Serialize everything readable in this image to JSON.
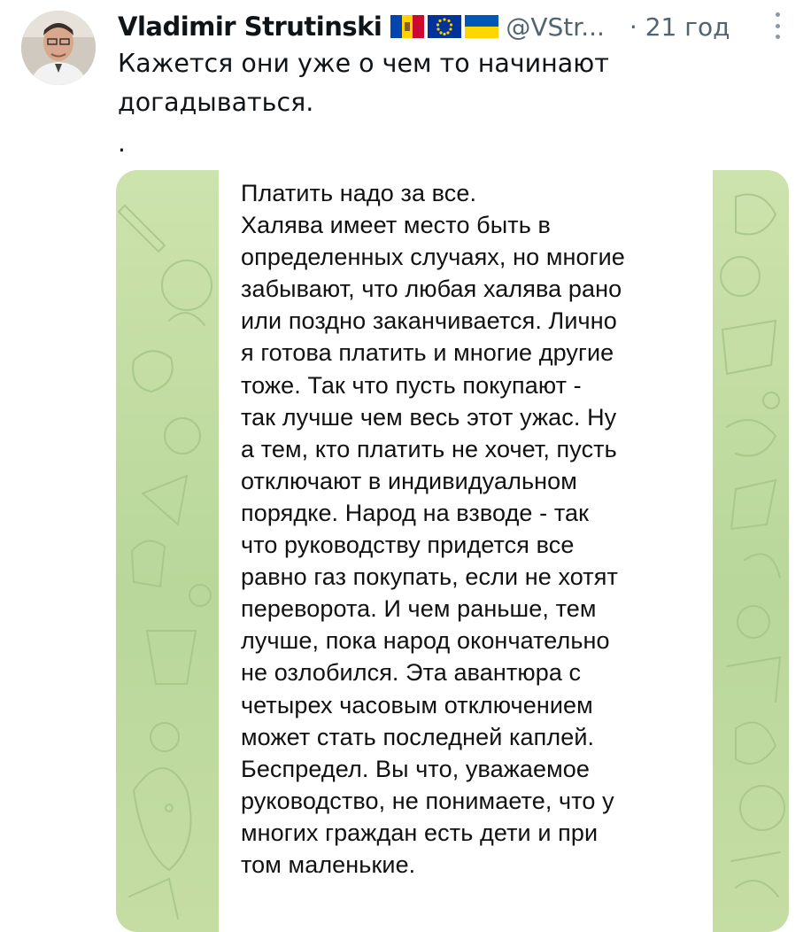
{
  "tweet": {
    "author_name": "Vladimir Strutinski",
    "flags": [
      "moldova-flag",
      "eu-flag",
      "ukraine-flag"
    ],
    "handle": "@VStr...",
    "time": "· 21 год",
    "text": "Кажется они уже о чем то начинают догадываться.",
    "extra_line": "."
  },
  "media": {
    "message_lines": [
      "Платить надо за все.",
      "Халява имеет место быть в",
      "определенных случаях, но многие",
      "забывают, что любая халява рано",
      "или поздно заканчивается. Лично",
      "я готова платить и многие другие",
      "тоже. Так что пусть покупают -",
      "так лучше чем весь этот ужас. Ну",
      "а тем, кто платить не хочет, пусть",
      "отключают в индивидуальном",
      "порядке. Народ на взводе - так",
      "что руководству придется все",
      "равно газ покупать, если не хотят",
      "переворота. И чем раньше, тем",
      "лучше, пока народ окончательно",
      "не озлобился. Эта авантюра с",
      "четырех часовым отключением",
      "может стать последней каплей.",
      "Беспредел. Вы что, уважаемое",
      "руководство, не понимаете, что у",
      "многих граждан есть дети и при",
      "том маленькие."
    ]
  },
  "colors": {
    "text": "#0f1419",
    "secondary": "#536471",
    "chat_bg": "#c2dca3"
  }
}
